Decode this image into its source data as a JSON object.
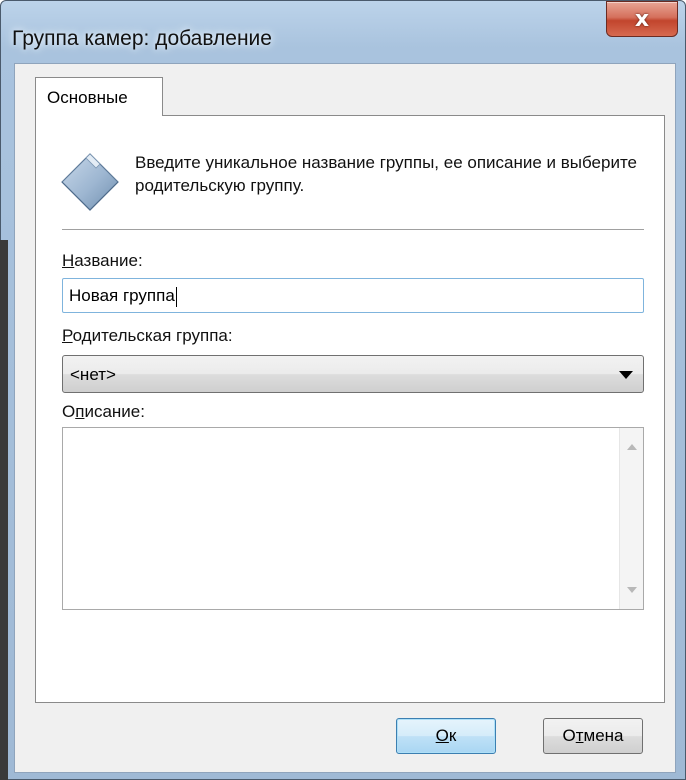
{
  "window": {
    "title": "Группа камер: добавление",
    "close_glyph": "x"
  },
  "tabs": [
    {
      "label": "Основные",
      "selected": true
    }
  ],
  "instruction": "Введите уникальное название группы, ее описание и выберите родительскую группу.",
  "fields": {
    "name": {
      "label_access_key": "Н",
      "label_rest": "азвание:",
      "value": "Новая группа"
    },
    "parent": {
      "label_access_key": "Р",
      "label_rest": "одительская группа:",
      "selected": "<нет>"
    },
    "description": {
      "label_prefix": "О",
      "label_access_key": "п",
      "label_rest": "исание:",
      "value": ""
    }
  },
  "buttons": {
    "ok": {
      "access_key": "О",
      "rest": "к"
    },
    "cancel": {
      "prefix": "О",
      "access_key": "т",
      "rest": "мена"
    }
  },
  "icons": {
    "folder": "folder-icon",
    "close": "close-icon",
    "dropdown": "chevron-down-icon"
  },
  "colors": {
    "title_bar": "#a9c3de",
    "close_button": "#c2452d",
    "default_button_border": "#3c7fb1",
    "input_focus_border": "#7fb4dd"
  }
}
